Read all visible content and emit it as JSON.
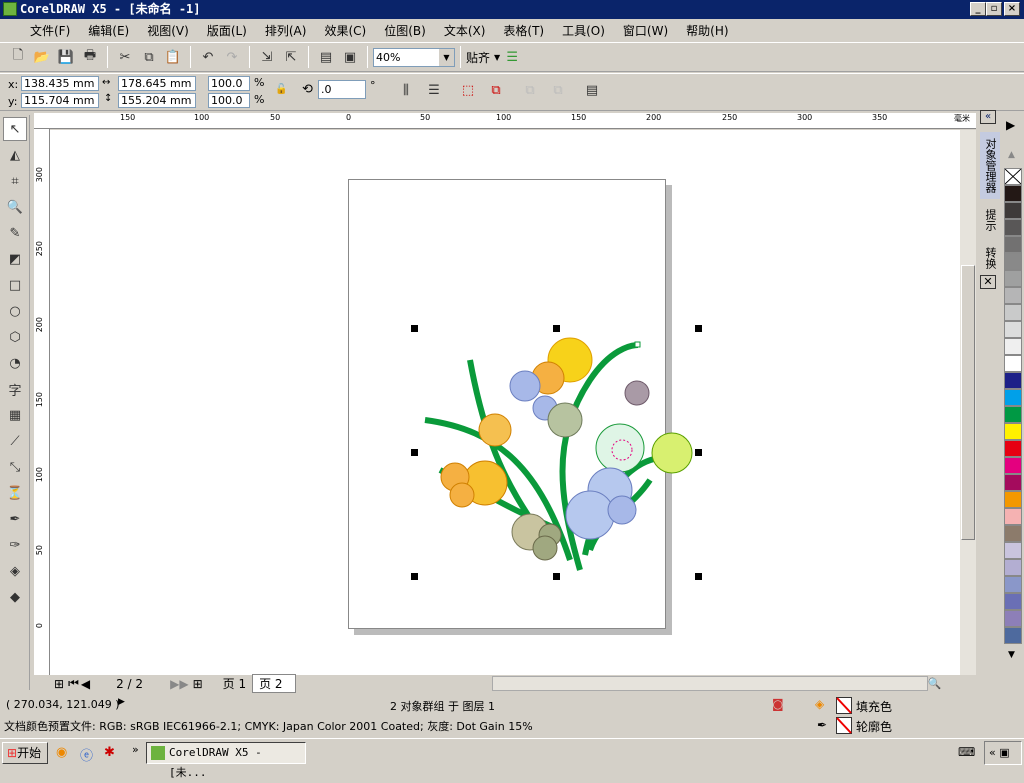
{
  "window": {
    "title": "CorelDRAW X5 - [未命名 -1]"
  },
  "menu": [
    "文件(F)",
    "编辑(E)",
    "视图(V)",
    "版面(L)",
    "排列(A)",
    "效果(C)",
    "位图(B)",
    "文本(X)",
    "表格(T)",
    "工具(O)",
    "窗口(W)",
    "帮助(H)"
  ],
  "toolbar": {
    "zoom": "40%",
    "snap": "贴齐"
  },
  "props": {
    "x_label": "x:",
    "y_label": "y:",
    "x": "138.435 mm",
    "y": "115.704 mm",
    "w": "178.645 mm",
    "h": "155.204 mm",
    "scale_x": "100.0",
    "scale_y": "100.0",
    "pct": "%",
    "angle": ".0",
    "deg": "°"
  },
  "ruler": {
    "unit": "毫米",
    "top": [
      "150",
      "100",
      "50",
      "0",
      "50",
      "100",
      "150",
      "200",
      "250",
      "300",
      "350"
    ],
    "left": [
      "300",
      "250",
      "200",
      "150",
      "100",
      "50",
      "0"
    ]
  },
  "dockers": [
    "对象管理器",
    "提示",
    "转换"
  ],
  "pages": {
    "counter": "2 / 2",
    "tabs": [
      "页 1",
      "页 2"
    ]
  },
  "status": {
    "coords": "( 270.034, 121.049 )",
    "selection": "2 对象群组 于 图层 1",
    "profile": "文档颜色预置文件: RGB: sRGB IEC61966-2.1; CMYK: Japan Color 2001 Coated; 灰度: Dot Gain 15%",
    "fill": "填充色",
    "outline": "轮廓色"
  },
  "taskbar": {
    "start": "开始",
    "task": "CorelDRAW X5 - [未..."
  },
  "palette": [
    "#231815",
    "#3e3a39",
    "#595757",
    "#727171",
    "#898989",
    "#9fa0a0",
    "#b5b5b6",
    "#c9caca",
    "#dcdddd",
    "#efefef",
    "#ffffff",
    "#1d2088",
    "#00a0e9",
    "#009944",
    "#fff100",
    "#e60012",
    "#e4007f",
    "#a40b5d",
    "#f39800",
    "#f5b2b2",
    "#8c7b6b",
    "#c9c4de",
    "#b3aed2",
    "#8a97c9",
    "#6a6fb5",
    "#8d7fb8",
    "#4e6a9e"
  ]
}
